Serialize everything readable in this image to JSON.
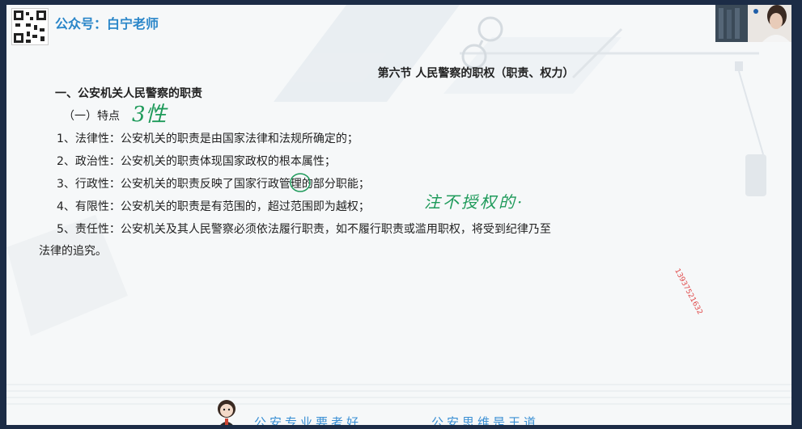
{
  "header": {
    "account_label": "公众号：白宁老师"
  },
  "slide": {
    "title": "第六节  人民警察的职权（职责、权力）",
    "heading": "一、公安机关人民警察的职责",
    "subheading": "（一）特点",
    "items": [
      {
        "label": "1、法律性：公安机关的职责是由国家法律和法规所确定的；"
      },
      {
        "label": "2、政治性：公安机关的职责体现国家政权的根本属性；"
      },
      {
        "label": "3、行政性：公安机关的职责反映了国家行政管理的部分职能；"
      },
      {
        "label": "4、有限性：公安机关的职责是有范围的，超过范围即为越权；"
      },
      {
        "label": "5、责任性：公安机关及其人民警察必须依法履行职责，如不履行职责或滥用职权，将受到纪律乃至"
      }
    ],
    "item5_continued": "法律的追究。",
    "handwriting_1": "3性",
    "handwriting_2": "注不授权的·",
    "watermark_number": "13937521632"
  },
  "footer": {
    "slogan_left": "公安专业要考好",
    "slogan_right": "公安思维是王道"
  },
  "colors": {
    "accent": "#2a86c9",
    "handwriting": "#1e9a5a",
    "watermark": "#e04a4a",
    "slogan": "#3a8fd4"
  }
}
